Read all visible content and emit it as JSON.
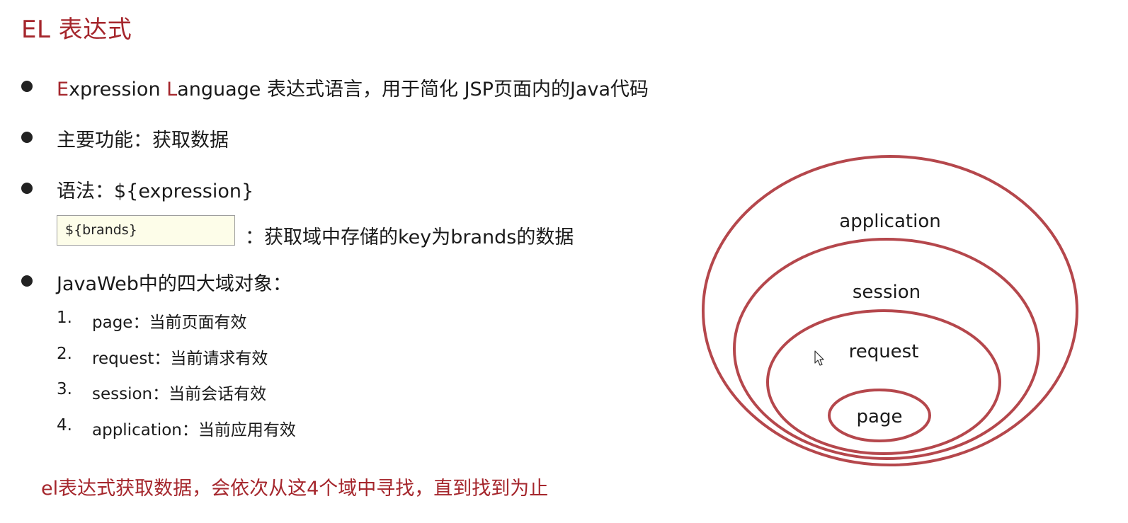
{
  "title": "EL 表达式",
  "bullets": {
    "b1": {
      "e_initial": "E",
      "e_rest": "xpression ",
      "l_initial": "L",
      "l_rest": "anguage 表达式语言，用于简化 JSP页面内的Java代码"
    },
    "b2": "主要功能：获取数据",
    "b3": "语法：${expression}",
    "b3_example_code": "${brands}",
    "b3_example_desc": "：获取域中存储的key为brands的数据",
    "b4": "JavaWeb中的四大域对象："
  },
  "scopes_list": [
    {
      "num": "1.",
      "text": "page：当前页面有效"
    },
    {
      "num": "2.",
      "text": "request：当前请求有效"
    },
    {
      "num": "3.",
      "text": "session：当前会话有效"
    },
    {
      "num": "4.",
      "text": "application：当前应用有效"
    }
  ],
  "note": "el表达式获取数据，会依次从这4个域中寻找，直到找到为止",
  "diagram": {
    "color": "#b5474c",
    "labels": {
      "application": "application",
      "session": "session",
      "request": "request",
      "page": "page"
    }
  },
  "icons": [
    "cursor-icon"
  ]
}
